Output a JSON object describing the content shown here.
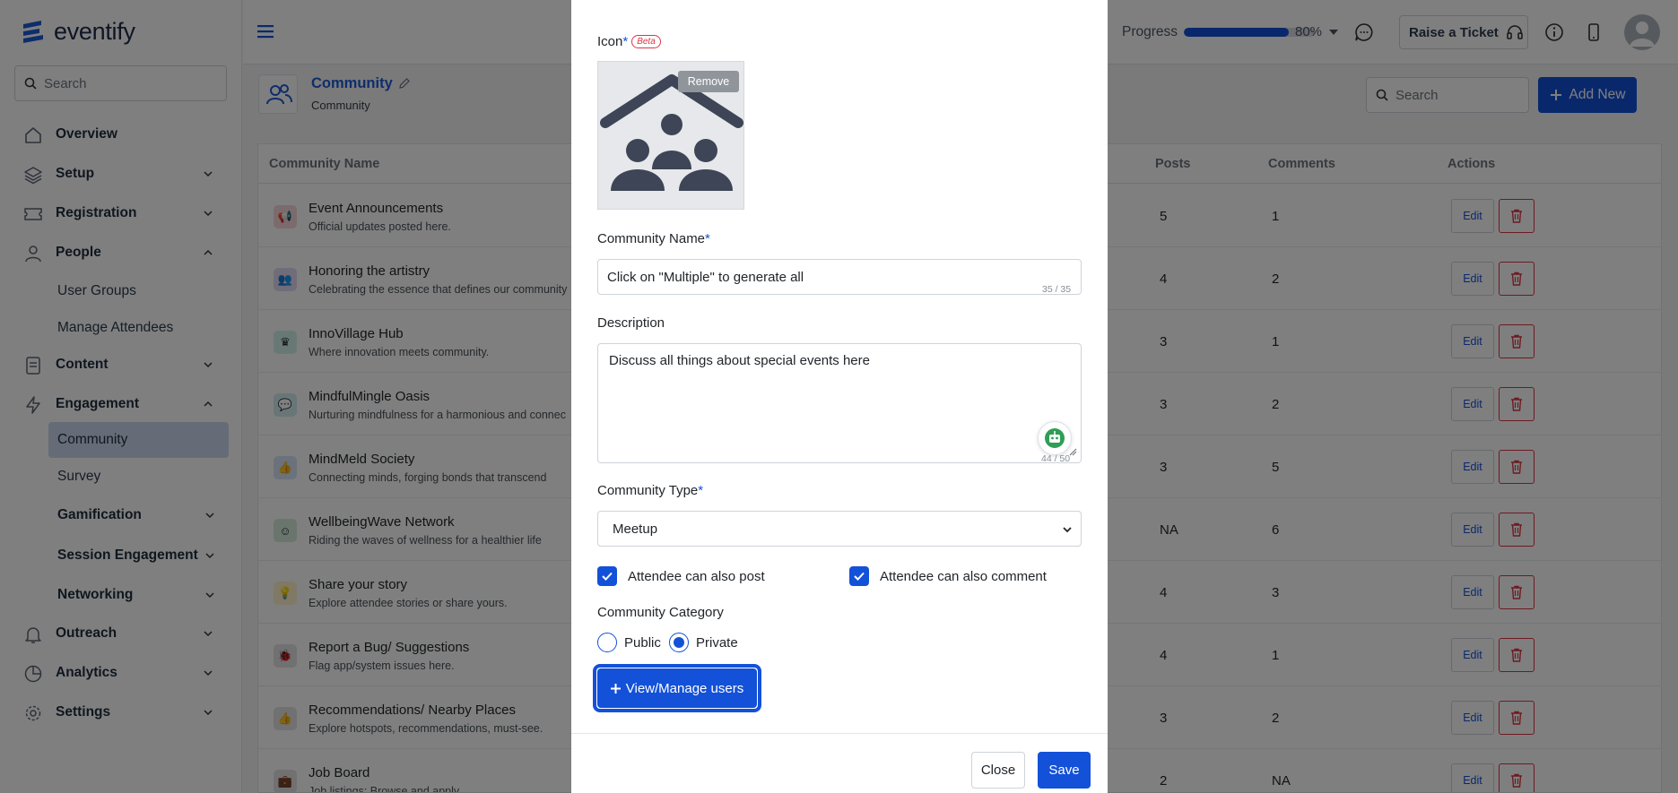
{
  "brand": {
    "name": "eventify"
  },
  "sidebar": {
    "search_placeholder": "Search",
    "items": [
      {
        "label": "Overview"
      },
      {
        "label": "Setup"
      },
      {
        "label": "Registration"
      },
      {
        "label": "People"
      },
      {
        "label": "Content"
      },
      {
        "label": "Engagement"
      },
      {
        "label": "Outreach"
      },
      {
        "label": "Analytics"
      },
      {
        "label": "Settings"
      }
    ],
    "people_sub": [
      "User Groups",
      "Manage Attendees"
    ],
    "engagement_sub": [
      "Community",
      "Survey"
    ],
    "engagement_groups": [
      "Gamification",
      "Session Engagement",
      "Networking"
    ]
  },
  "topbar": {
    "progress_label": "Progress",
    "progress_value": 80,
    "progress_text": "80%",
    "raise_ticket": "Raise a Ticket"
  },
  "page": {
    "title": "Community",
    "breadcrumb": "Community",
    "search_placeholder": "Search",
    "add_new": "Add New"
  },
  "table": {
    "headers": {
      "name": "Community Name",
      "posts": "Posts",
      "comments": "Comments",
      "actions": "Actions"
    },
    "edit_label": "Edit",
    "rows": [
      {
        "name": "Event Announcements",
        "desc": "Official updates posted here.",
        "posts": "5",
        "comments": "1",
        "color": "#f8d7da",
        "glyph": "📢"
      },
      {
        "name": "Honoring the artistry",
        "desc": "Celebrating the essence that defines our community",
        "posts": "4",
        "comments": "2",
        "color": "#e2d9f3",
        "glyph": "👥"
      },
      {
        "name": "InnoVillage Hub",
        "desc": "Where innovation meets community.",
        "posts": "3",
        "comments": "1",
        "color": "#d1f2eb",
        "glyph": "♛"
      },
      {
        "name": "MindfulMingle Oasis",
        "desc": "Nurturing mindfulness for a harmonious and connec",
        "posts": "3",
        "comments": "2",
        "color": "#d1ecf1",
        "glyph": "💬"
      },
      {
        "name": "MindMeld Society",
        "desc": "Connecting minds, forging bonds that transcend",
        "posts": "3",
        "comments": "5",
        "color": "#d6e4f7",
        "glyph": "👍"
      },
      {
        "name": "WellbeingWave Network",
        "desc": "Riding the waves of wellness for a healthier life",
        "posts": "NA",
        "comments": "6",
        "color": "#d4edda",
        "glyph": "☺"
      },
      {
        "name": "Share your story",
        "desc": "Explore attendee stories or share yours.",
        "posts": "4",
        "comments": "3",
        "color": "#fff3cd",
        "glyph": "💡"
      },
      {
        "name": "Report a Bug/ Suggestions",
        "desc": "Flag app/system issues here.",
        "posts": "4",
        "comments": "1",
        "color": "#e2e3e5",
        "glyph": "🐞"
      },
      {
        "name": "Recommendations/ Nearby Places",
        "desc": "Explore hotspots, recommendations, must-see.",
        "posts": "3",
        "comments": "2",
        "color": "#e2e3e5",
        "glyph": "👍"
      },
      {
        "name": "Job Board",
        "desc": "Job listings: Browse and apply.",
        "posts": "2",
        "comments": "NA",
        "color": "#e2e3e5",
        "glyph": "💼"
      }
    ]
  },
  "modal": {
    "icon_label": "Icon",
    "required_mark": "*",
    "beta": "Beta",
    "remove": "Remove",
    "name_label": "Community Name",
    "name_value": "Click on \"Multiple\" to generate all",
    "name_counter": "35 / 35",
    "description_label": "Description",
    "description_value": "Discuss all things about special events here",
    "description_counter": "44 / 50",
    "type_label": "Community Type",
    "type_value": "Meetup",
    "post_check": "Attendee can also post",
    "comment_check": "Attendee can also comment",
    "category_label": "Community Category",
    "public": "Public",
    "private": "Private",
    "category_selected": "Private",
    "view_manage": "View/Manage users",
    "close": "Close",
    "save": "Save"
  },
  "colors": {
    "primary": "#1351d8",
    "danger": "#dc3545",
    "active_nav": "#cbd9ef"
  }
}
